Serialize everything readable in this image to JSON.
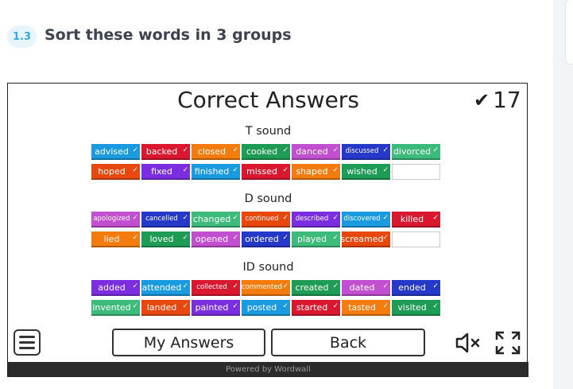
{
  "exercise": {
    "number": "1.3",
    "title": "Sort these words in 3 groups"
  },
  "game": {
    "title": "Correct Answers",
    "score": "17",
    "groups": [
      {
        "label": "T sound",
        "rows": [
          [
            {
              "word": "advised",
              "color": "#1a9be0"
            },
            {
              "word": "backed",
              "color": "#d9172e"
            },
            {
              "word": "closed",
              "color": "#f47c0f"
            },
            {
              "word": "cooked",
              "color": "#1e9b55"
            },
            {
              "word": "danced",
              "color": "#c24fcf"
            },
            {
              "word": "discussed",
              "color": "#2638c7"
            },
            {
              "word": "divorced",
              "color": "#3dbb7a"
            }
          ],
          [
            {
              "word": "hoped",
              "color": "#e8480e"
            },
            {
              "word": "fixed",
              "color": "#7b2ee0"
            },
            {
              "word": "finished",
              "color": "#1a9be0"
            },
            {
              "word": "missed",
              "color": "#d9172e"
            },
            {
              "word": "shaped",
              "color": "#f47c0f"
            },
            {
              "word": "wished",
              "color": "#1e9b55"
            }
          ]
        ]
      },
      {
        "label": "D sound",
        "rows": [
          [
            {
              "word": "apologized",
              "color": "#c24fcf"
            },
            {
              "word": "cancelled",
              "color": "#2638c7"
            },
            {
              "word": "changed",
              "color": "#3dbb7a"
            },
            {
              "word": "continued",
              "color": "#e8480e"
            },
            {
              "word": "described",
              "color": "#7b2ee0"
            },
            {
              "word": "discovered",
              "color": "#1a9be0"
            },
            {
              "word": "killed",
              "color": "#d9172e"
            }
          ],
          [
            {
              "word": "lied",
              "color": "#f47c0f"
            },
            {
              "word": "loved",
              "color": "#1e9b55"
            },
            {
              "word": "opened",
              "color": "#c24fcf"
            },
            {
              "word": "ordered",
              "color": "#2638c7"
            },
            {
              "word": "played",
              "color": "#3dbb7a"
            },
            {
              "word": "screamed",
              "color": "#e8480e"
            }
          ]
        ]
      },
      {
        "label": "ID sound",
        "rows": [
          [
            {
              "word": "added",
              "color": "#7b2ee0"
            },
            {
              "word": "attended",
              "color": "#1a9be0"
            },
            {
              "word": "collected",
              "color": "#d9172e"
            },
            {
              "word": "commented",
              "color": "#f47c0f"
            },
            {
              "word": "created",
              "color": "#1e9b55"
            },
            {
              "word": "dated",
              "color": "#c24fcf"
            },
            {
              "word": "ended",
              "color": "#2638c7"
            }
          ],
          [
            {
              "word": "invented",
              "color": "#3dbb7a"
            },
            {
              "word": "landed",
              "color": "#e8480e"
            },
            {
              "word": "painted",
              "color": "#7b2ee0"
            },
            {
              "word": "posted",
              "color": "#1a9be0"
            },
            {
              "word": "started",
              "color": "#d9172e"
            },
            {
              "word": "tasted",
              "color": "#f47c0f"
            },
            {
              "word": "visited",
              "color": "#1e9b55"
            }
          ]
        ]
      }
    ],
    "controls": {
      "my_answers": "My Answers",
      "back": "Back"
    },
    "footer": "Powered by Wordwall",
    "icons": [
      "checkmark-icon",
      "menu-icon",
      "mute-icon",
      "fullscreen-icon"
    ]
  }
}
